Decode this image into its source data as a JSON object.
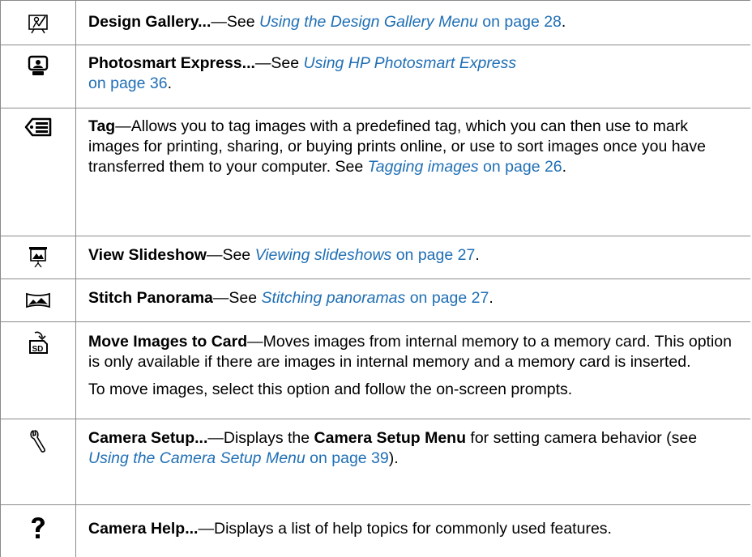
{
  "rows": [
    {
      "icon": "design-gallery-icon",
      "title": "Design Gallery...",
      "dash": "—See ",
      "link": "Using the Design Gallery Menu",
      "page": " on page 28",
      "end": "."
    },
    {
      "icon": "photosmart-express-icon",
      "title": "Photosmart Express...",
      "dash": "—See ",
      "link": "Using HP Photosmart Express",
      "page": "on page 36",
      "end": "."
    },
    {
      "icon": "tag-icon",
      "title": "Tag",
      "text": "—Allows you to tag images with a predefined tag, which you can then use to mark images for printing, sharing, or buying prints online, or use to sort images once you have transferred them to your computer. See ",
      "link": "Tagging images",
      "page": " on page 26",
      "end": "."
    },
    {
      "icon": "slideshow-icon",
      "title": "View Slideshow",
      "dash": "—See ",
      "link": "Viewing slideshows",
      "page": " on page 27",
      "end": "."
    },
    {
      "icon": "panorama-icon",
      "title": "Stitch Panorama",
      "dash": "—See ",
      "link": "Stitching panoramas",
      "page": " on page 27",
      "end": "."
    },
    {
      "icon": "sd-card-move-icon",
      "title": "Move Images to Card",
      "text": "—Moves images from internal memory to a memory card. This option is only available if there are images in internal memory and a memory card is inserted.",
      "text2": "To move images, select this option and follow the on-screen prompts."
    },
    {
      "icon": "wrench-icon",
      "title": "Camera Setup...",
      "text": "—Displays the ",
      "bold2": "Camera Setup Menu",
      "text2": " for setting camera behavior (see ",
      "link": "Using the Camera Setup Menu",
      "page": " on page 39",
      "end": ")."
    },
    {
      "icon": "help-question-icon",
      "title": "Camera Help...",
      "text": "—Displays a list of help topics for commonly used features."
    }
  ]
}
